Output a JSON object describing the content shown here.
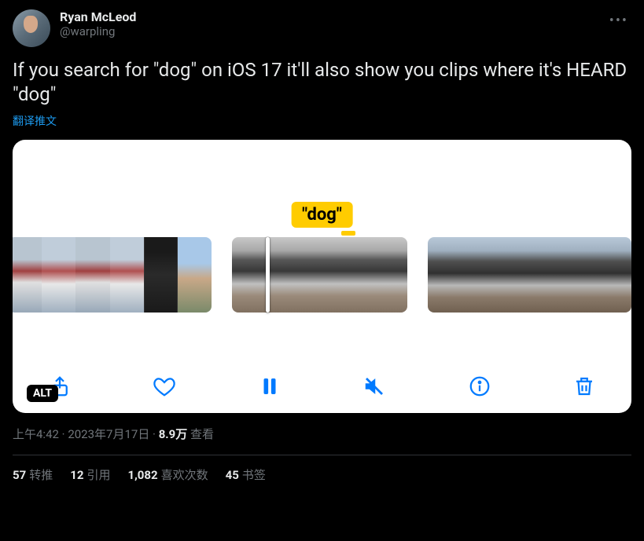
{
  "author": {
    "display_name": "Ryan McLeod",
    "handle": "@warpling"
  },
  "body_text": "If you search for \"dog\" on iOS 17 it'll also show you clips where it's HEARD \"dog\"",
  "translate_label": "翻译推文",
  "media": {
    "caption_text": "\"dog\"",
    "alt_badge": "ALT",
    "toolbar_icons": {
      "share": "share-icon",
      "like": "heart-icon",
      "pause": "pause-icon",
      "mute": "mute-icon",
      "info": "info-icon",
      "trash": "trash-icon"
    }
  },
  "meta": {
    "time": "上午4:42",
    "date": "2023年7月17日",
    "views_number": "8.9万",
    "views_label": "查看",
    "separator": " · "
  },
  "stats": {
    "retweets": {
      "count": "57",
      "label": "转推"
    },
    "quotes": {
      "count": "12",
      "label": "引用"
    },
    "likes": {
      "count": "1,082",
      "label": "喜欢次数"
    },
    "bookmarks": {
      "count": "45",
      "label": "书签"
    }
  }
}
